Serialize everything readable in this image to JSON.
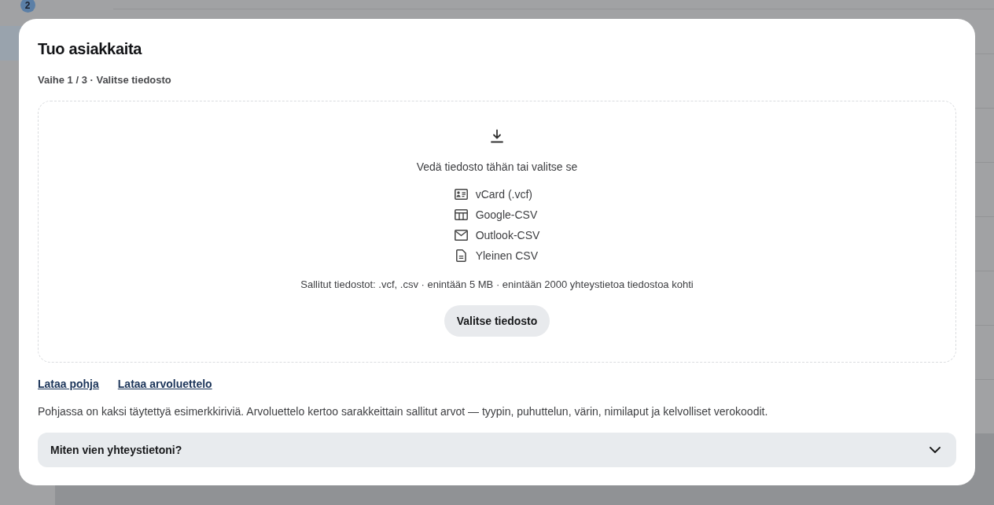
{
  "background": {
    "badge": "2"
  },
  "dialog": {
    "title": "Tuo asiakkaita",
    "step": "Vaihe 1 / 3 · Valitse tiedosto",
    "dropzone": {
      "prompt": "Vedä tiedosto tähän tai valitse se",
      "formats": [
        {
          "kind": "vcard",
          "label": "vCard (.vcf)"
        },
        {
          "kind": "table",
          "label": "Google-CSV"
        },
        {
          "kind": "mail",
          "label": "Outlook-CSV"
        },
        {
          "kind": "document",
          "label": "Yleinen CSV"
        }
      ],
      "limits": "Sallitut tiedostot: .vcf, .csv · enintään 5 MB · enintään 2000 yhteystietoa tiedostoa kohti",
      "button": "Valitse tiedosto"
    },
    "links": [
      "Lataa pohja",
      "Lataa arvoluettelo"
    ],
    "note": "Pohjassa on kaksi täytettyä esimerkkiriviä. Arvoluettelo kertoo sarakkeittain sallitut arvot — tyypin, puhuttelun, värin, nimilaput ja kelvolliset verokoodit.",
    "accordion": {
      "title": "Miten vien yhteystietoni?",
      "expanded": false
    }
  }
}
